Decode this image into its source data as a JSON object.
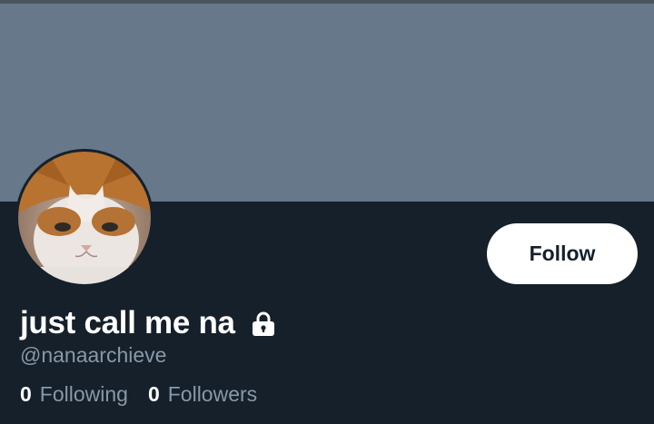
{
  "profile": {
    "display_name": "just call me na",
    "handle": "@nanaarchieve",
    "protected_icon": "lock-icon",
    "avatar_description_icon": "cat-avatar"
  },
  "actions": {
    "follow_label": "Follow"
  },
  "stats": {
    "following_count": "0",
    "following_label": "Following",
    "followers_count": "0",
    "followers_label": "Followers"
  },
  "colors": {
    "background": "#15202b",
    "banner": "#66788a",
    "primary_text": "#ffffff",
    "secondary_text": "#8899a6",
    "button_bg": "#ffffff",
    "button_text": "#15202b"
  }
}
